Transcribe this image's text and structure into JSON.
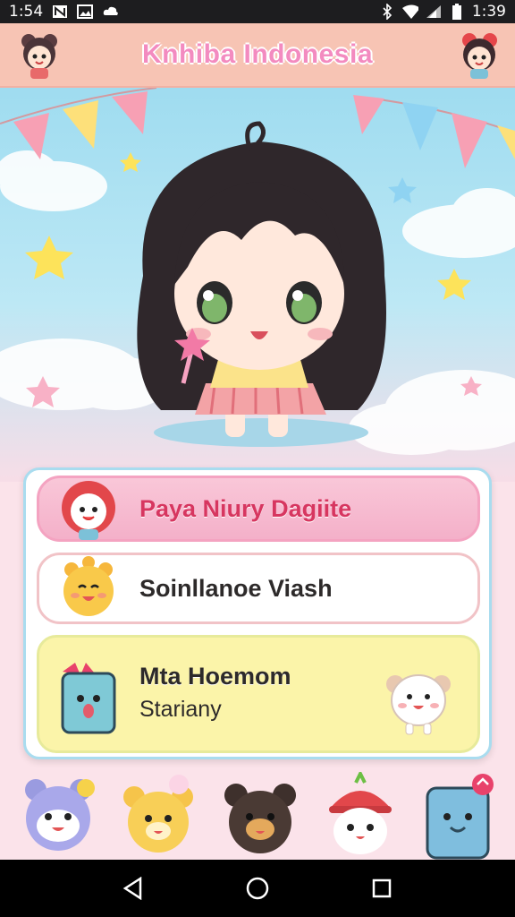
{
  "status_bar": {
    "time_left": "1:54",
    "time_right": "1:39",
    "icons": [
      "n-icon",
      "image-icon",
      "cloud-icon",
      "bluetooth-icon",
      "wifi-icon",
      "signal-icon",
      "battery-icon"
    ]
  },
  "header": {
    "title": "Knhiba Indonesia",
    "left_avatar": "girl-avatar-icon",
    "right_avatar": "red-hair-girl-avatar-icon"
  },
  "menu": {
    "items": [
      {
        "label": "Paya Niury Dagiite",
        "icon": "red-lion-mascot-icon"
      },
      {
        "label": "Soinllanoe Viash",
        "icon": "yellow-sun-mascot-icon"
      },
      {
        "label": "Mta Hoemom",
        "sub": "Stariany",
        "icon": "blue-box-mascot-icon",
        "side_icon": "white-mouse-mascot-icon"
      }
    ]
  },
  "mascots": [
    "purple-bunny-icon",
    "yellow-bear-icon",
    "brown-bear-icon",
    "red-hat-bird-icon",
    "blue-robot-icon"
  ],
  "colors": {
    "header_bg": "#f7c4b4",
    "title": "#f38bc0",
    "accent_pink": "#f4b0c9",
    "accent_yellow": "#fbf4a9",
    "frame": "#a9dcef"
  },
  "navbar": {
    "buttons": [
      "back-icon",
      "home-icon",
      "recents-icon"
    ]
  }
}
